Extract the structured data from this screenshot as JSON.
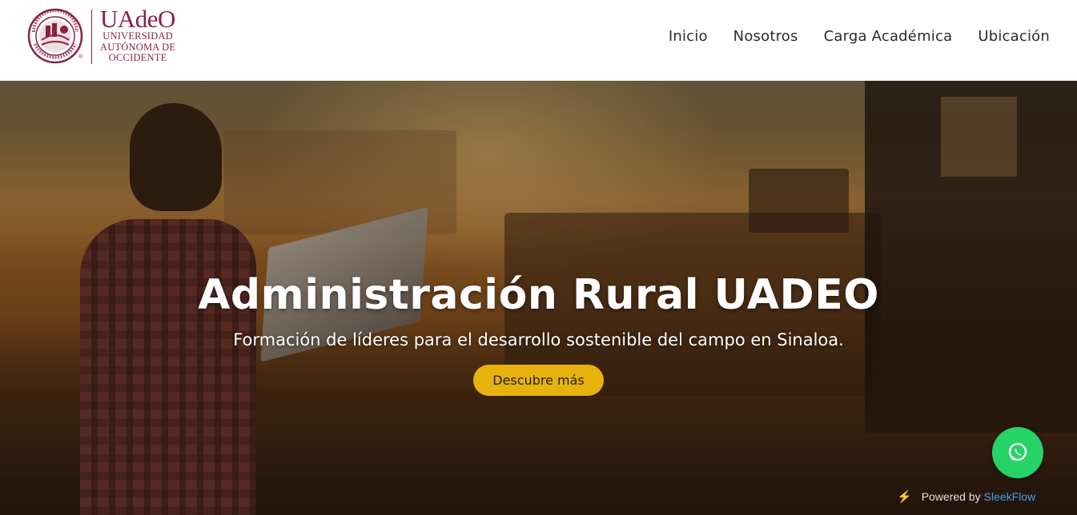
{
  "header": {
    "logo": {
      "wordmark": "UAdeO",
      "line1": "UNIVERSIDAD",
      "line2": "AUTÓNOMA DE",
      "line3": "OCCIDENTE",
      "registered": "®",
      "seal_text_top": "POR LA CULTURA A LA LIBERTAD",
      "seal_text_bottom": "SINALOA"
    },
    "nav": [
      {
        "label": "Inicio"
      },
      {
        "label": "Nosotros"
      },
      {
        "label": "Carga Académica"
      },
      {
        "label": "Ubicación"
      }
    ]
  },
  "hero": {
    "title": "Administración Rural UADEO",
    "subtitle": "Formación de líderes para el desarrollo sostenible del campo en Sinaloa.",
    "cta_label": "Descubre más"
  },
  "widgets": {
    "whatsapp_icon": "whatsapp-icon",
    "powered_prefix": "Powered by",
    "powered_brand": "SleekFlow"
  },
  "colors": {
    "brand": "#8a2240",
    "cta": "#e8b20e",
    "whatsapp": "#25d366",
    "sleekflow": "#4a9fe8"
  }
}
